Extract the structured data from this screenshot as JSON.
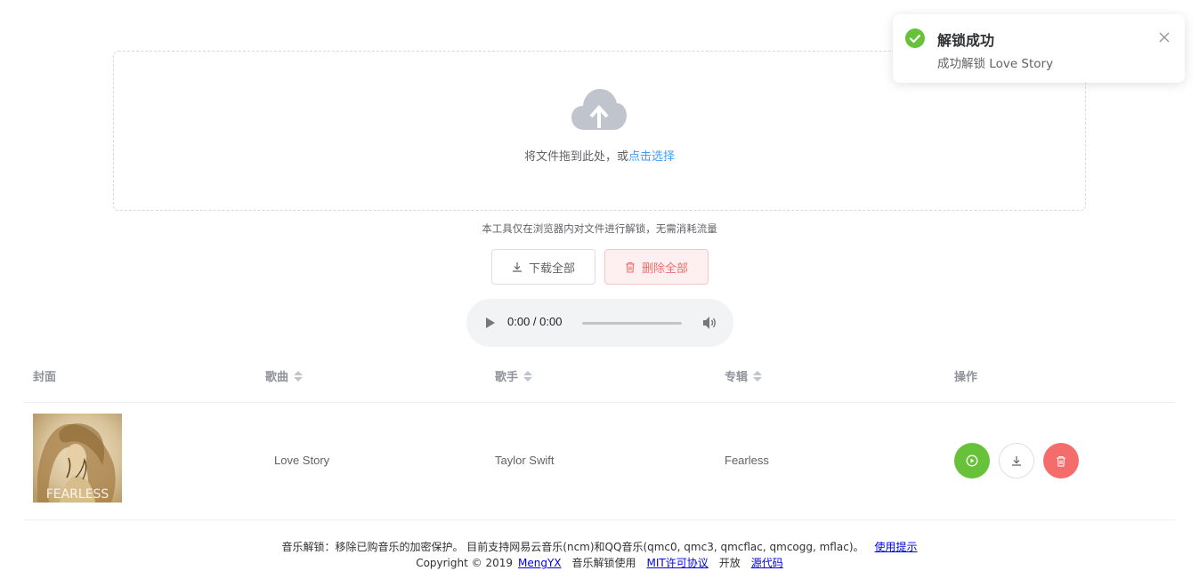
{
  "upload": {
    "drag_text": "将文件拖到此处，或",
    "click_text": "点击选择",
    "tip": "本工具仅在浏览器内对文件进行解锁，无需消耗流量"
  },
  "actions": {
    "download_all": "下载全部",
    "delete_all": "删除全部"
  },
  "audio": {
    "time": "0:00 / 0:00"
  },
  "table": {
    "headers": {
      "cover": "封面",
      "song": "歌曲",
      "artist": "歌手",
      "album": "专辑",
      "actions": "操作"
    },
    "rows": [
      {
        "cover_text": "FEARLESS",
        "song": "Love Story",
        "artist": "Taylor Swift",
        "album": "Fearless"
      }
    ]
  },
  "footer": {
    "line1": "音乐解锁：移除已购音乐的加密保护。 目前支持网易云音乐(ncm)和QQ音乐(qmc0, qmc3, qmcflac, qmcogg, mflac)。",
    "help_link": "使用提示",
    "copyright": "Copyright © 2019",
    "author": "MengYX",
    "uses": "音乐解锁使用",
    "license": "MIT许可协议",
    "open": "开放",
    "source": "源代码"
  },
  "toast": {
    "title": "解锁成功",
    "message": "成功解锁 Love Story"
  },
  "colors": {
    "primary": "#409eff",
    "success": "#67c23a",
    "danger": "#f56c6c",
    "border": "#dcdfe6"
  }
}
